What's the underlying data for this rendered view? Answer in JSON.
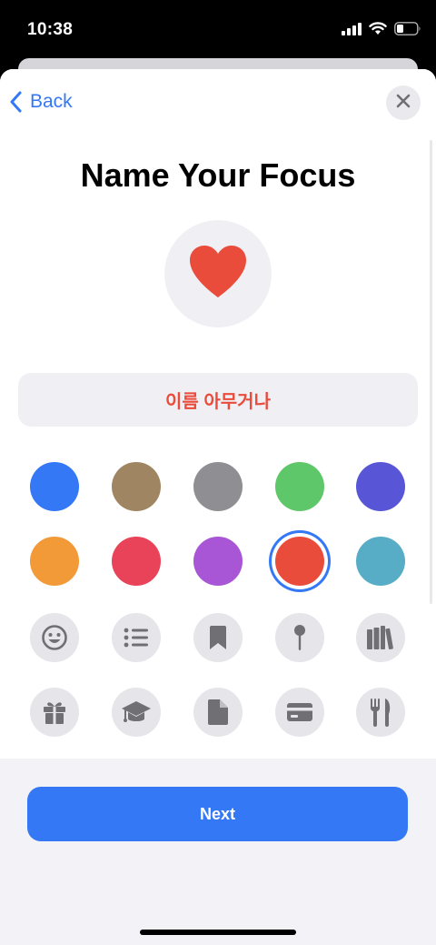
{
  "status": {
    "time": "10:38",
    "icons": [
      "cellular-signal-icon",
      "wifi-icon",
      "battery-icon"
    ]
  },
  "nav": {
    "back_label": "Back",
    "close_icon": "close-icon"
  },
  "title": "Name Your Focus",
  "preview": {
    "icon": "heart-icon",
    "color": "#ea4c3c"
  },
  "name_field": {
    "value": "이름 아무거나"
  },
  "colors": [
    {
      "name": "blue",
      "hex": "#3478f6"
    },
    {
      "name": "brown",
      "hex": "#a08562"
    },
    {
      "name": "gray",
      "hex": "#8e8e93"
    },
    {
      "name": "green",
      "hex": "#5ec76a"
    },
    {
      "name": "indigo",
      "hex": "#5856d6"
    },
    {
      "name": "orange",
      "hex": "#f19a37"
    },
    {
      "name": "pink",
      "hex": "#e9435a"
    },
    {
      "name": "purple",
      "hex": "#a856d6"
    },
    {
      "name": "red",
      "hex": "#ea4c3c",
      "selected": true
    },
    {
      "name": "teal",
      "hex": "#57adc6"
    }
  ],
  "icons": [
    "smiley-icon",
    "list-icon",
    "bookmark-icon",
    "pin-icon",
    "books-icon",
    "gift-icon",
    "graduation-cap-icon",
    "document-icon",
    "credit-card-icon",
    "fork-knife-icon"
  ],
  "icon_color": "#6f6f74",
  "next_label": "Next"
}
